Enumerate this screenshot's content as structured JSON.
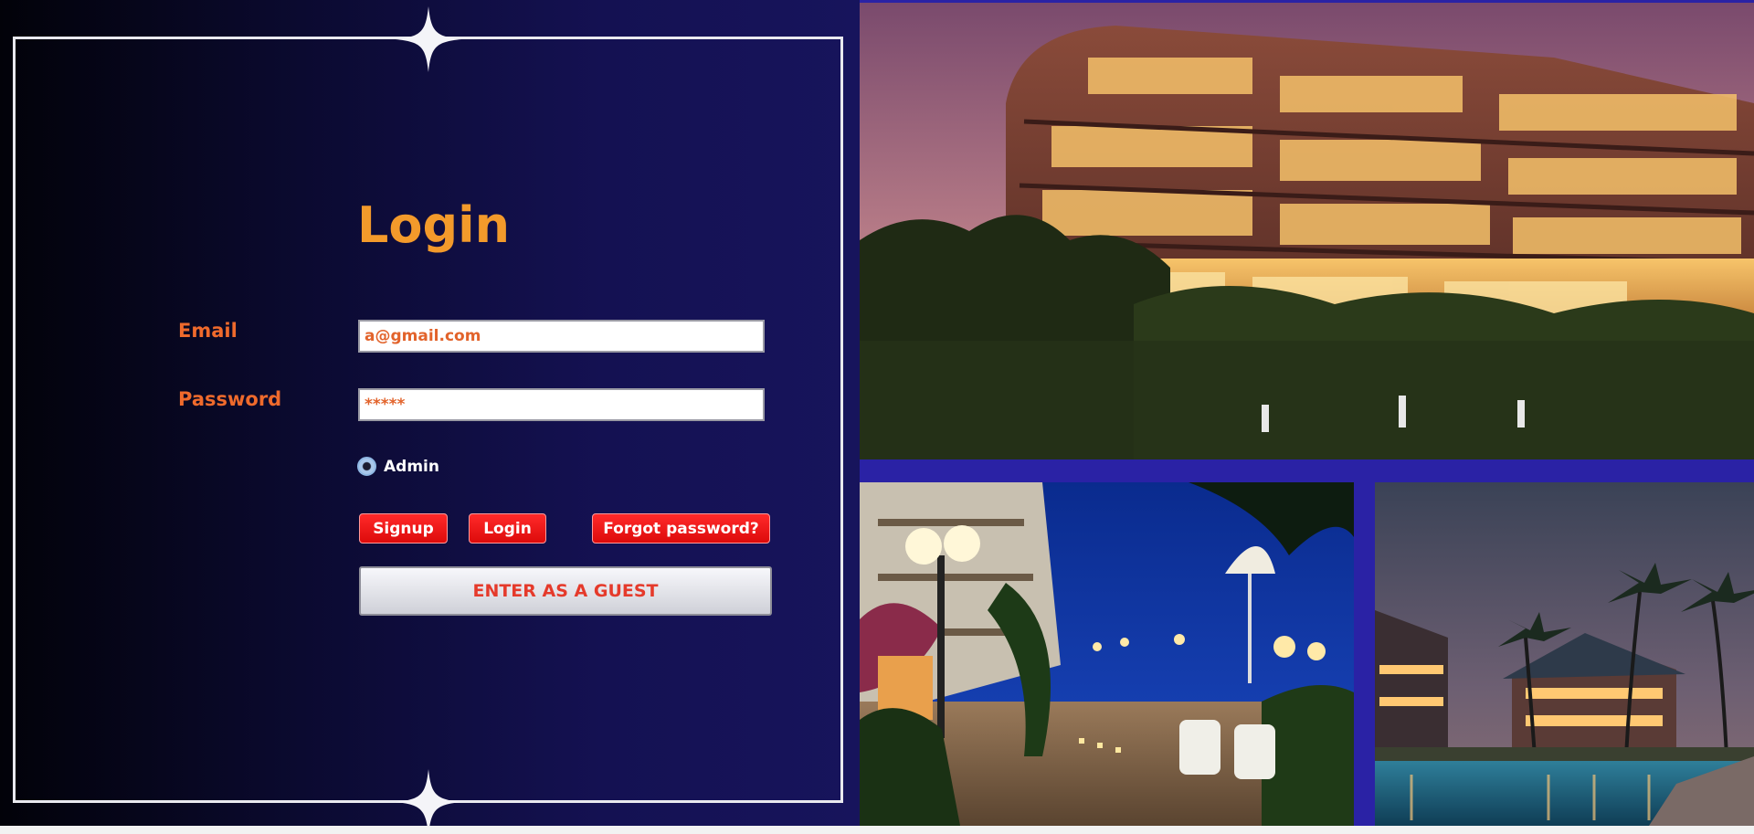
{
  "login": {
    "title": "Login",
    "email_label": "Email",
    "email_value": "a@gmail.com",
    "password_label": "Password",
    "password_value": "*****",
    "role_option": "Admin",
    "role_selected": true
  },
  "buttons": {
    "signup": "Signup",
    "login": "Login",
    "forgot": "Forgot password?",
    "guest": "ENTER AS A GUEST"
  },
  "colors": {
    "accent_orange": "#f39a2b",
    "label_orange": "#ef6a2c",
    "button_red": "#ff1a1a",
    "panel_navy": "#17145c",
    "side_blue": "#2a22a5"
  },
  "images": [
    {
      "name": "hotel-building-photo"
    },
    {
      "name": "courtyard-night-photo"
    },
    {
      "name": "resort-pool-photo"
    }
  ]
}
